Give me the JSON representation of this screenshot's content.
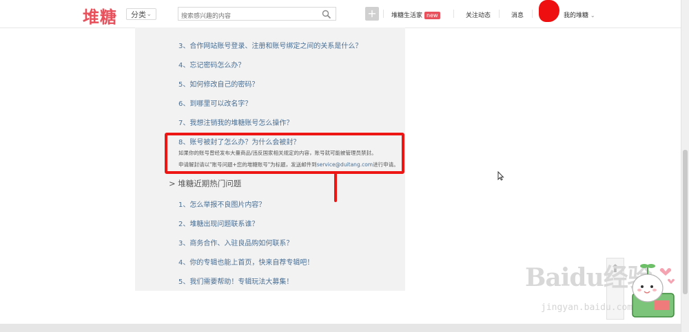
{
  "header": {
    "logo": "堆糖",
    "category_label": "分类",
    "search_placeholder": "搜索感兴趣的内容",
    "nav": {
      "life_home": "堆糖生活家",
      "new_badge": "new",
      "follow_feed": "关注动态",
      "messages": "消息",
      "my_duitang": "我的堆糖"
    }
  },
  "faq": {
    "items": [
      "3、合作网站账号登录、注册和账号绑定之间的关系是什么？",
      "4、忘记密码怎么办？",
      "5、如何修改自己的密码？",
      "6、到哪里可以改名字？",
      "7、我想注销我的堆糖账号怎么操作？"
    ],
    "highlighted": {
      "question": "8、账号被封了怎么办？为什么会被封？",
      "answer_line1": "如果你的账号曾经发布大量商品/违反国家相关规定的内容，账号就可能被管理员禁封。",
      "answer_line2_prefix": "申请解封请以\"账号问题+您的堆糖账号\"为标题，发送邮件到",
      "answer_email": "service@duitang.com",
      "answer_line2_suffix": "进行申请。"
    },
    "section_title": "> 堆糖近期热门问题",
    "hot_items": [
      "1、怎么举报不良图片内容？",
      "2、堆糖出现问题联系谁？",
      "3、商务合作、入驻良品购如何联系？",
      "4、你的专辑也能上首页，快来自荐专辑吧！",
      "5、我们需要帮助！专辑玩法大募集！"
    ]
  },
  "watermark": {
    "logo_text": "Baidu经验",
    "url_text": "jingyan.baidu.com"
  },
  "colors": {
    "brand": "#e8505b",
    "link": "#4a6f94",
    "highlight_border": "#ee1515"
  },
  "icons": [
    "search-icon",
    "plus-icon",
    "chevron-down-icon",
    "back-to-top-icon",
    "cursor-icon"
  ]
}
